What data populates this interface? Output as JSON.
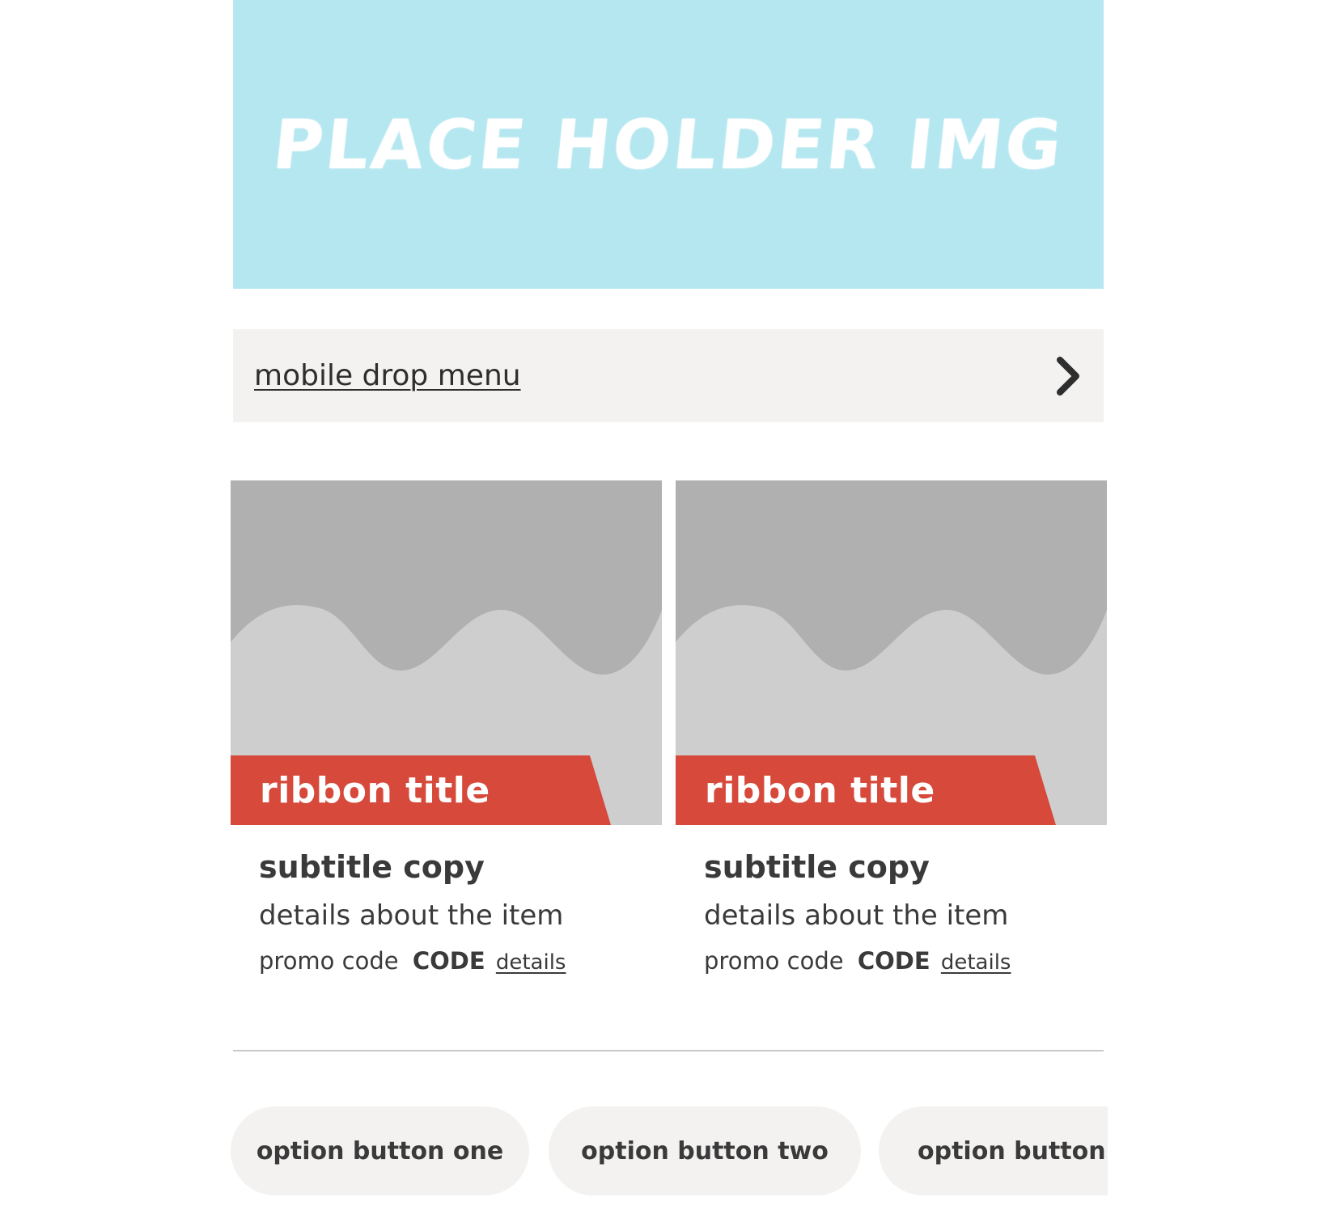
{
  "hero": {
    "text": "PLACE HOLDER IMG",
    "background": "#b4e7f0"
  },
  "drop_menu": {
    "label": "mobile drop menu",
    "icon": "chevron-right-icon"
  },
  "cards": [
    {
      "ribbon_title": "ribbon title",
      "subtitle": "subtitle copy",
      "details": "details about the item",
      "promo_label": "promo code",
      "promo_code": "CODE",
      "details_link": "details"
    },
    {
      "ribbon_title": "ribbon title",
      "subtitle": "subtitle copy",
      "details": "details about the item",
      "promo_label": "promo code",
      "promo_code": "CODE",
      "details_link": "details"
    }
  ],
  "options": [
    {
      "label": "option button one"
    },
    {
      "label": "option button two"
    },
    {
      "label": "option button three"
    }
  ],
  "colors": {
    "ribbon": "#d6493b",
    "image_dark": "#b0b0b0",
    "image_light": "#cfcecf",
    "menu_bg": "#f3f2f1",
    "divider": "#c9c9c9"
  }
}
